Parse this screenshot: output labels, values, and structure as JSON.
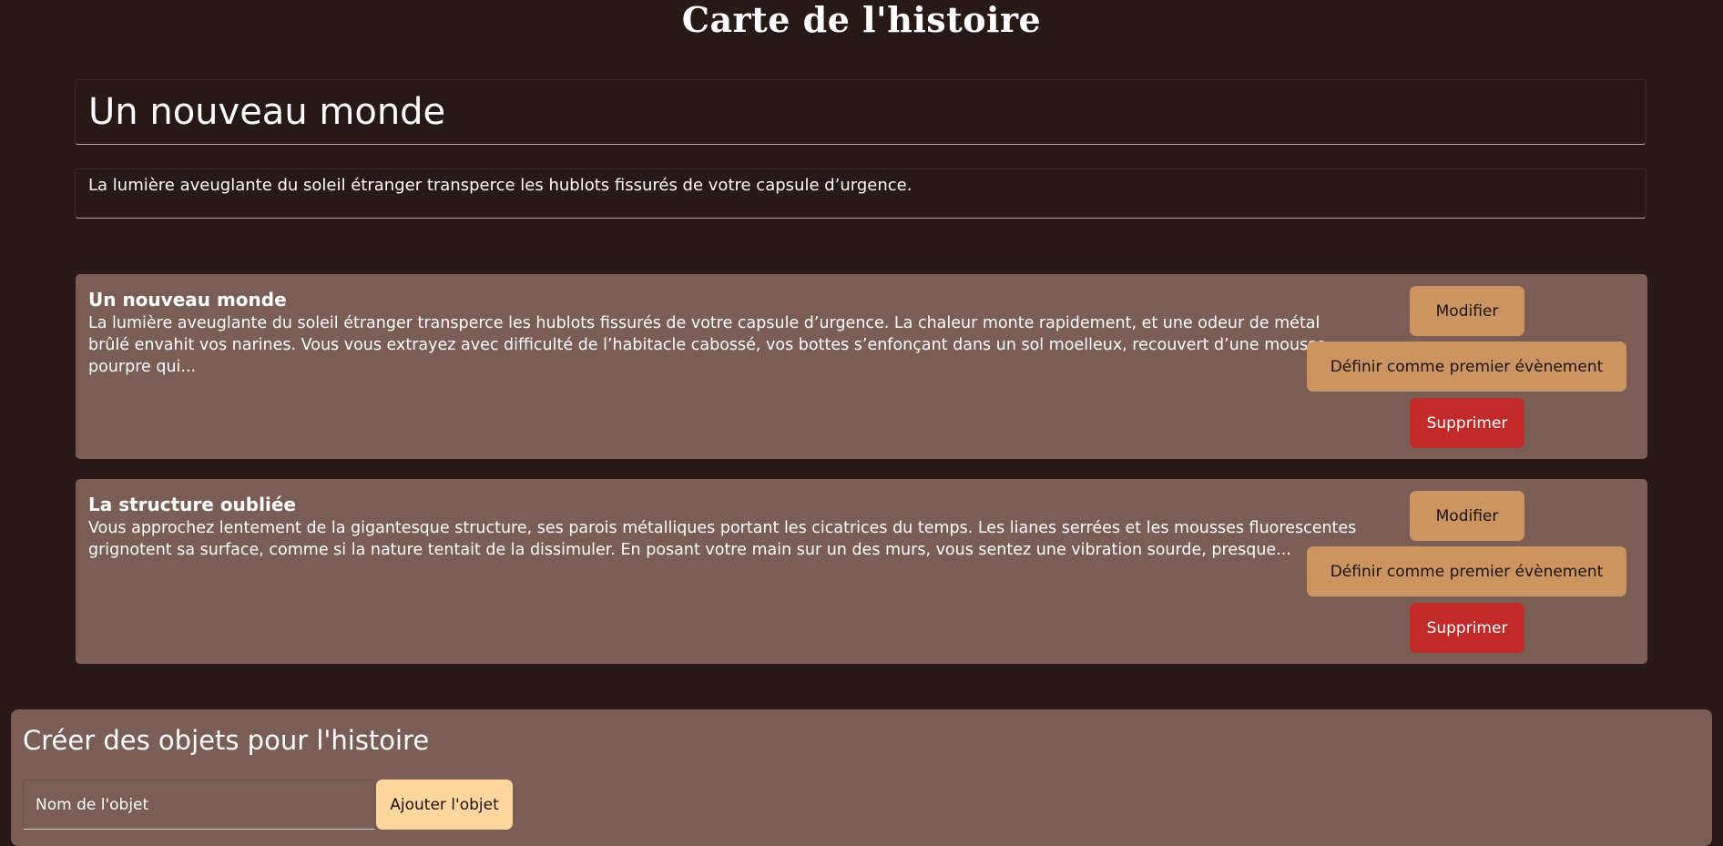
{
  "page": {
    "title": "Carte de l'histoire"
  },
  "story": {
    "title_value": "Un nouveau monde",
    "description_value": "La lumière aveuglante du soleil étranger transperce les hublots fissurés de votre capsule d’urgence."
  },
  "events": [
    {
      "title": "Un nouveau monde",
      "text": "La lumière aveuglante du soleil étranger transperce les hublots fissurés de votre capsule d’urgence. La chaleur monte rapidement, et une odeur de métal brûlé envahit vos narines. Vous vous extrayez avec difficulté de l’habitacle cabossé, vos bottes s’enfonçant dans un sol moelleux, recouvert d’une mousse pourpre qui...",
      "edit_label": "Modifier",
      "set_first_label": "Définir comme premier évènement",
      "delete_label": "Supprimer"
    },
    {
      "title": "La structure oubliée",
      "text": "Vous approchez lentement de la gigantesque structure, ses parois métalliques portant les cicatrices du temps. Les lianes serrées et les mousses fluorescentes grignotent sa surface, comme si la nature tentait de la dissimuler. En posant votre main sur un des murs, vous sentez une vibration sourde, presque...",
      "edit_label": "Modifier",
      "set_first_label": "Définir comme premier évènement",
      "delete_label": "Supprimer"
    }
  ],
  "objects": {
    "title": "Créer des objets pour l'histoire",
    "name_placeholder": "Nom de l'objet",
    "add_label": "Ajouter l'objet"
  },
  "colors": {
    "background": "#261916",
    "card": "#7a5e55",
    "primary_button": "#cc9461",
    "danger_button": "#c22a2a",
    "add_button": "#ffd69e"
  }
}
